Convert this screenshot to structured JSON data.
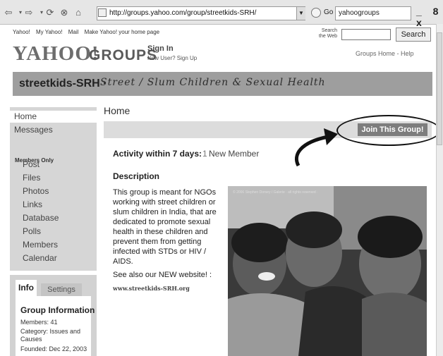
{
  "browser": {
    "address": "http://groups.yahoo.com/group/streetkids-SRH/",
    "go_label": "Go",
    "search_box": "yahoogroups",
    "window_controls": "_ 8 x"
  },
  "yahoo_bar": {
    "links": [
      "Yahoo!",
      "My Yahoo!",
      "Mail",
      "Make Yahoo! your home page"
    ],
    "search_web_label": "Search the Web",
    "search_button": "Search"
  },
  "header": {
    "logo_yahoo": "YAHOO!",
    "logo_groups": "GROUPS",
    "sign_in": "Sign In",
    "new_user": "New User? Sign Up",
    "groups_home_help": "Groups Home - Help"
  },
  "banner": {
    "group_name": "streetkids-SRH ·",
    "tagline": "Street / Slum Children & Sexual Health"
  },
  "sidebar": {
    "top_items": [
      "Home",
      "Messages"
    ],
    "members_only_label": "Members Only",
    "member_items": [
      "Post",
      "Files",
      "Photos",
      "Links",
      "Database",
      "Polls",
      "Members",
      "Calendar"
    ]
  },
  "info_panel": {
    "tabs": [
      "Info",
      "Settings"
    ],
    "title": "Group Information",
    "lines": [
      "Members: 41",
      "Category: Issues and",
      "Causes",
      "Founded: Dec 22, 2003"
    ]
  },
  "main": {
    "title": "Home",
    "join_button": "Join This Group!",
    "activity_label": "Activity within 7 days:",
    "activity_num": "1",
    "activity_value": "New Member",
    "description_title": "Description",
    "description_text": "This group is meant for NGOs working with street children or slum children in India, that are dedicated to promote sexual health in these children and prevent them from getting infected with STDs or HIV / AIDS.",
    "see_also": "See also our NEW website! :",
    "website": "www.streetkids-SRH.org",
    "photo_caption": "© 2006 Stephen Dorsey / Galerie · all rights reserved ·"
  }
}
